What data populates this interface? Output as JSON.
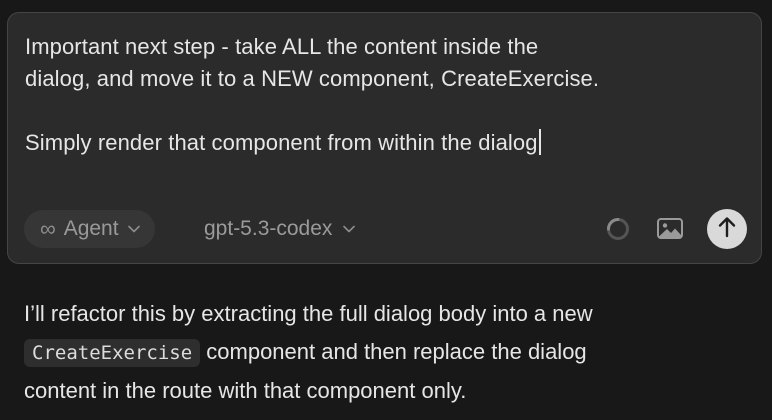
{
  "composer": {
    "prompt_line1": "Important next step - take ALL the content inside the",
    "prompt_line2": "dialog, and move it to a NEW component, CreateExercise.",
    "prompt_line3": "Simply render that component from within the dialog"
  },
  "toolbar": {
    "mode_label": "Agent",
    "model_label": "gpt-5.3-codex",
    "icons": [
      "infinity-icon",
      "chevron-down-icon",
      "spinner-icon",
      "image-icon",
      "arrow-up-icon"
    ]
  },
  "response": {
    "line1": "I’ll refactor this by extracting the full dialog body into a new",
    "code": "CreateExercise",
    "line2_rest": " component and then replace the dialog",
    "line3": "content in the route with that component only."
  },
  "colors": {
    "background": "#181818",
    "composer_bg": "#2b2b2b",
    "send_button": "#d9d9d9",
    "text": "#e6e6e6",
    "muted_text": "#9a9a9a"
  }
}
